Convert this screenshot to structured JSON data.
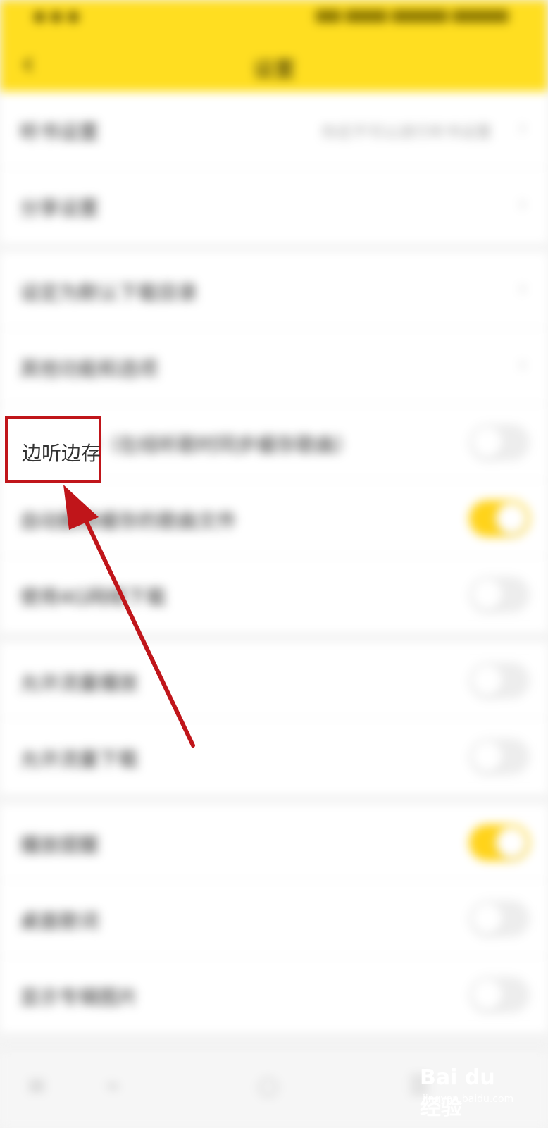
{
  "header": {
    "title": "设置",
    "back_icon": "chevron-left-icon"
  },
  "groups": [
    {
      "rows": [
        {
          "label": "听书设置",
          "value": "你还不可以进行听书设置",
          "control": "chevron"
        },
        {
          "label": "分享设置",
          "value": "",
          "control": "chevron"
        }
      ]
    },
    {
      "rows": [
        {
          "label": "设定为默认下载目录",
          "control": "chevron"
        },
        {
          "label": "其他功能和选项",
          "control": "chevron"
        },
        {
          "label": "边听边存（在线听歌时同步缓存歌曲）",
          "control": "toggle",
          "on": false
        },
        {
          "label": "自动删除缓存的歌曲文件",
          "control": "toggle",
          "on": true
        },
        {
          "label": "使用4G网络下载",
          "control": "toggle",
          "on": false
        }
      ]
    },
    {
      "rows": [
        {
          "label": "允许流量播放",
          "control": "toggle",
          "on": false
        },
        {
          "label": "允许流量下载",
          "control": "toggle",
          "on": false
        }
      ]
    },
    {
      "rows": [
        {
          "label": "播放提醒",
          "control": "toggle",
          "on": true
        },
        {
          "label": "桌面歌词",
          "control": "toggle",
          "on": false
        },
        {
          "label": "显示专辑图片",
          "control": "toggle",
          "on": false
        }
      ]
    }
  ],
  "bottom_bar": {
    "icons": [
      "list-icon",
      "trend-icon",
      "circle-icon",
      "menu-icon"
    ]
  },
  "annotation": {
    "label": "边听边存",
    "color": "#c0151a"
  },
  "watermark": {
    "brand": "Bai du 经验",
    "url": "jingyan.baidu.com"
  },
  "colors": {
    "accent": "#ffde21",
    "toggle_on": "#ffd31a"
  }
}
